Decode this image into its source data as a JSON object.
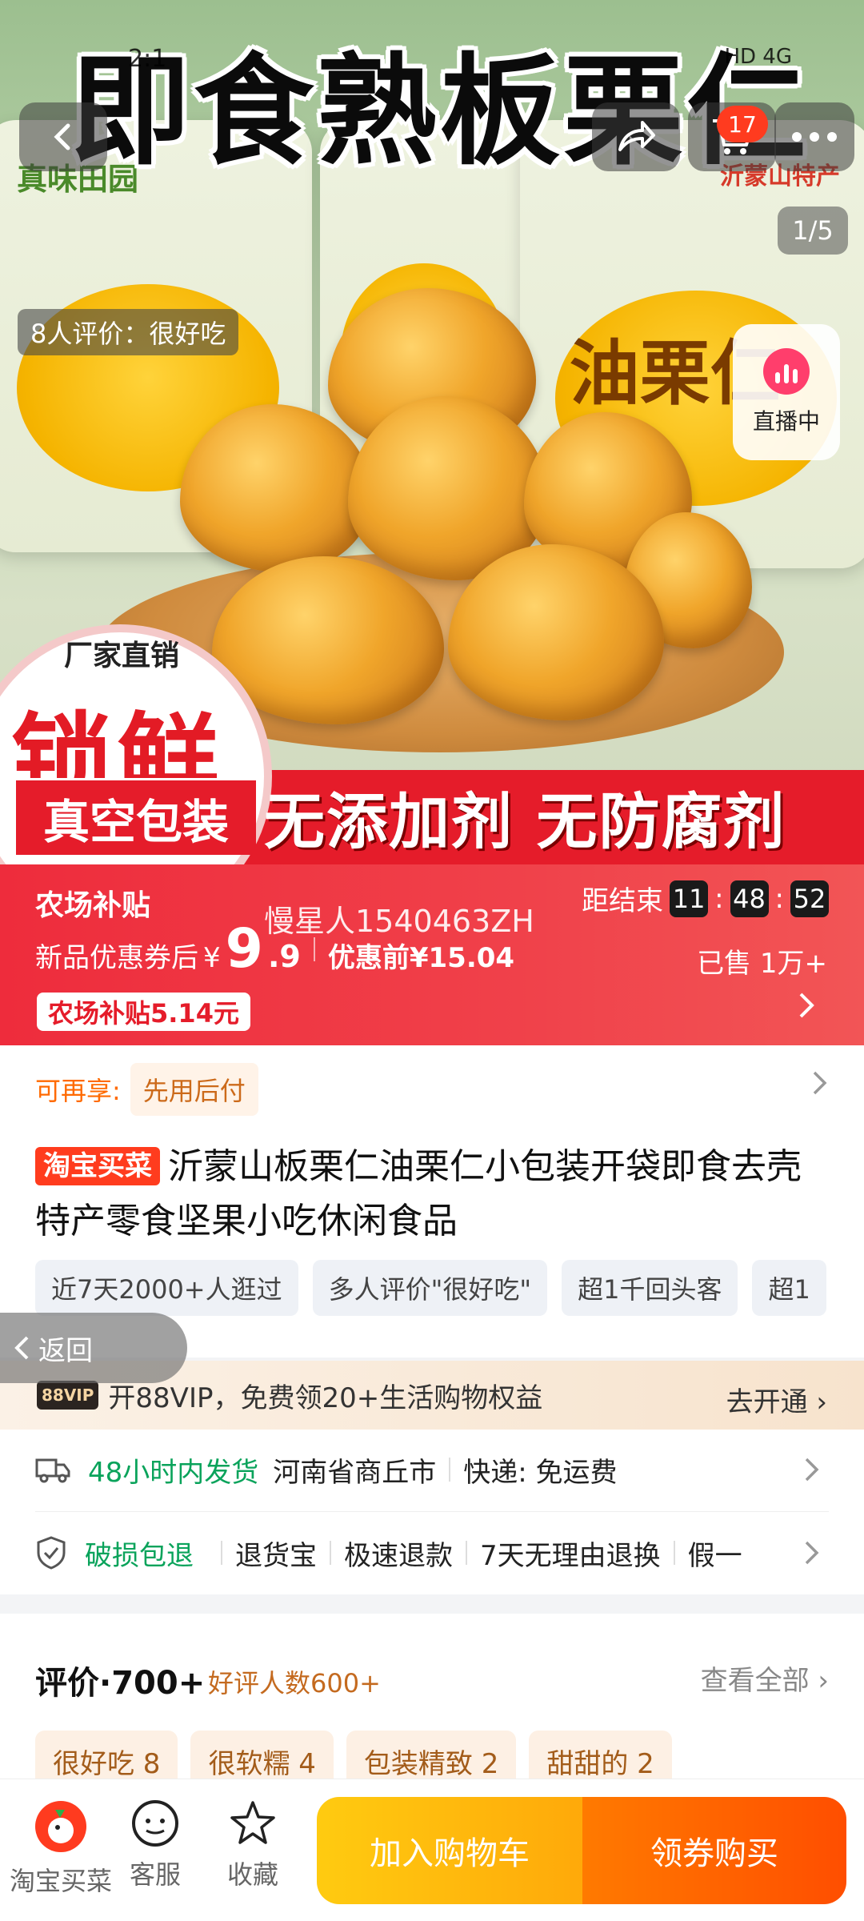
{
  "hero": {
    "title": "即食熟板栗仁",
    "status_time": "2:1",
    "status_right": "HD 4G",
    "image_counter": "1/5",
    "review_summary": "8人评价：很好吃",
    "live_label": "直播中",
    "cart_count": "17",
    "package_name": "油栗仁",
    "package_brand": "真味田园",
    "package_origin": "沂蒙山特产",
    "seal_top": "厂家直销",
    "seal_big": "锁鲜",
    "banner_left": "真空包装",
    "banner_right": "无添加剂 无防腐剂"
  },
  "price": {
    "farm_title": "农场补贴",
    "watermark": "慢星人1540463ZH",
    "countdown_label": "距结束",
    "countdown_h": "11",
    "countdown_m": "48",
    "countdown_s": "52",
    "coupon_label": "新品优惠券后",
    "yen": "¥",
    "price_int": "9",
    "price_dec": ".9",
    "old_price": "优惠前¥15.04",
    "sold": "已售 1万+",
    "subsidy_tag": "农场补贴5.14元"
  },
  "info": {
    "pay_label": "可再享:",
    "pay_chip": "先用后付",
    "title_badge": "淘宝买菜",
    "title": "沂蒙山板栗仁油栗仁小包装开袋即食去壳特产零食坚果小吃休闲食品",
    "tags": [
      "近7天2000+人逛过",
      "多人评价\"很好吃\"",
      "超1千回头客",
      "超1"
    ],
    "back_label": "返回"
  },
  "vip": {
    "badge": "88VIP",
    "text": "开88VIP，免费领20+生活购物权益",
    "cta": "去开通"
  },
  "shipping": {
    "speed": "48小时内发货",
    "location": "河南省商丘市",
    "express": "快递: 免运费"
  },
  "service": {
    "main": "破损包退",
    "items": [
      "退货宝",
      "极速退款",
      "7天无理由退换",
      "假一"
    ]
  },
  "reviews": {
    "title": "评价·700+",
    "good": "好评人数600+",
    "view_all": "查看全部",
    "tags": [
      "很好吃 8",
      "很软糯 4",
      "包装精致 2",
      "甜甜的 2"
    ]
  },
  "bottom": {
    "shop_label": "淘宝买菜",
    "service_label": "客服",
    "fav_label": "收藏",
    "add_cart": "加入购物车",
    "buy": "领券购买"
  }
}
